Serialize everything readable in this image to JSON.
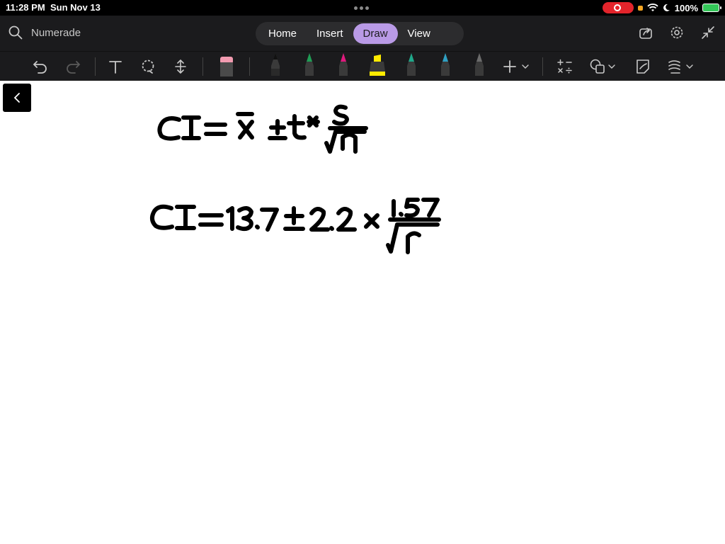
{
  "status_bar": {
    "time": "11:28 PM",
    "date": "Sun Nov 13",
    "battery": "100%"
  },
  "header": {
    "search_label": "Numerade",
    "tabs": [
      {
        "label": "Home"
      },
      {
        "label": "Insert"
      },
      {
        "label": "Draw",
        "active": true
      },
      {
        "label": "View"
      }
    ]
  },
  "toolbar": {
    "icons": [
      "undo-icon",
      "redo-icon",
      "text-icon",
      "lasso-icon",
      "space-icon",
      "eraser-icon",
      "pen-black-icon",
      "pen-green-icon",
      "pen-magenta-icon",
      "highlighter-yellow-icon",
      "pen-teal-icon",
      "pen-blue-icon",
      "pencil-gray-icon",
      "add-pen-icon",
      "math-icon",
      "shapes-icon",
      "ink-to-shape-icon",
      "ink-options-icon"
    ],
    "pen_colors": {
      "black": "#111111",
      "green": "#1f9d55",
      "magenta": "#e0197d",
      "yellow": "#ffeb00",
      "teal": "#1fa88a",
      "blue": "#2f9fc2",
      "gray": "#6b6b6b"
    }
  },
  "colors": {
    "accent": "#b99ae6",
    "toolbar_bg": "#1b1b1d"
  }
}
